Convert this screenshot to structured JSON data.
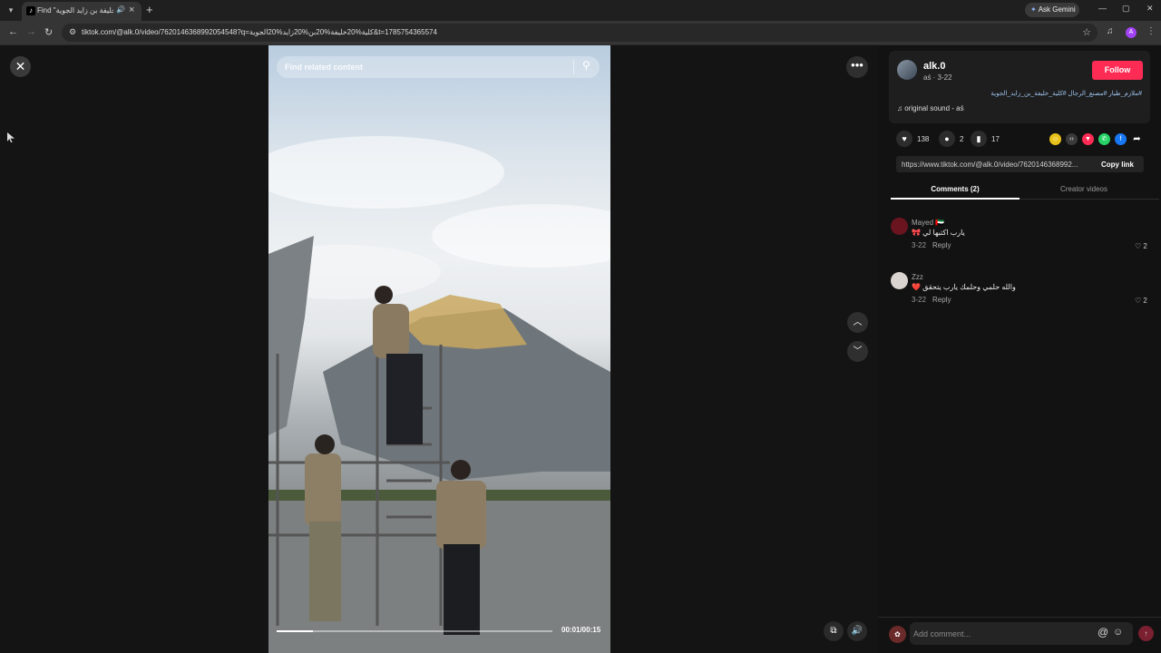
{
  "browser": {
    "tab_title": "Find \"ملازم طيار\" كلية خليفة بن زايد الجوية",
    "tab_audio_icon": "🔊",
    "ask_gemini": "Ask Gemini",
    "url": "tiktok.com/@alk.0/video/7620146368992054548?q=كلية%20خليفة%20بن%20زايد%20الجوية&t=1785754365574",
    "profile_initial": "A"
  },
  "video": {
    "search_placeholder": "Find related content",
    "time": "00:01/00:15",
    "progress": 0.13
  },
  "author": {
    "name": "alk.0",
    "meta": "aś · 3-22",
    "follow_label": "Follow",
    "hashtags": "#ملازم_طيار #مصنع_الرجال #كلية_خليفة_بن_زايد_الجوية",
    "sound": "original sound - aś"
  },
  "stats": {
    "likes": "138",
    "comments": "2",
    "saves": "17"
  },
  "share": {
    "link": "https://www.tiktok.com/@alk.0/video/7620146368992...",
    "copy_label": "Copy link"
  },
  "tabs": {
    "comments": "Comments (2)",
    "creator_videos": "Creator videos"
  },
  "comments": [
    {
      "user": "Mayed 🇦🇪",
      "text": "يارب اكتبها لي 🎀",
      "date": "3-22",
      "reply": "Reply",
      "likes": "2",
      "avatar_color": "#6a1420"
    },
    {
      "user": "Zzz",
      "text": "والله حلمي وحلمك يارب يتحقق ❤️",
      "date": "3-22",
      "reply": "Reply",
      "likes": "2",
      "avatar_color": "#d9d4cf"
    }
  ],
  "composer": {
    "placeholder": "Add comment..."
  },
  "colors": {
    "accent": "#fe2c55",
    "link": "#9ec5f0"
  }
}
